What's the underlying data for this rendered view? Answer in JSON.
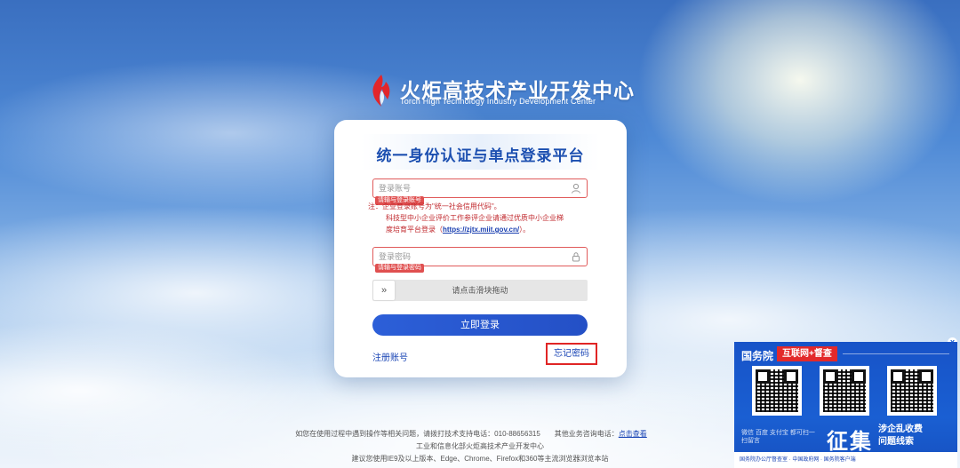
{
  "header": {
    "logo_cn": "火炬高技术产业开发中心",
    "logo_en": "Torch High Technology Industry Development Center"
  },
  "login": {
    "title": "统一身份认证与单点登录平台",
    "account_placeholder": "登录账号",
    "account_error": "请输与登录账号",
    "note_line1": "注：企业登录账号为\"统一社会信用代码\"。",
    "note_line2": "科技型中小企业评价工作参评企业请通过优质中小企业梯",
    "note_line3_prefix": "度培育平台登录（",
    "note_link": "https://zjtx.miit.gov.cn/",
    "note_line3_suffix": "）。",
    "password_placeholder": "登录密码",
    "password_error": "请输与登录密码",
    "slider_label": "请点击滑块拖动",
    "slider_handle": "»",
    "login_button": "立即登录",
    "register_link": "注册账号",
    "forgot_link": "忘记密码"
  },
  "footer": {
    "support_text": "如您在使用过程中遇到操作等相关问题，请拨打技术支持电话：010-88656315",
    "business_text": "其他业务咨询电话：",
    "business_link": "点击查看",
    "org": "工业和信息化部火炬高技术产业开发中心",
    "browser_hint": "建议您使用IE9及以上版本、Edge、Chrome、Firefox和360等主流浏览器浏览本站"
  },
  "ad": {
    "title": "国务院",
    "badge": "互联网+督查",
    "big_text": "征集",
    "side_line1": "涉企乱收费",
    "side_line2": "问题线索",
    "small_text": "微信 百度 支付宝 都可扫一扫留言",
    "foot_text": "国务院办公厅督查室 · 中国政府网 · 国务院客户端",
    "close": "x"
  },
  "colors": {
    "primary": "#2c5fd8",
    "error": "#e05050",
    "title": "#1c4fb0"
  }
}
